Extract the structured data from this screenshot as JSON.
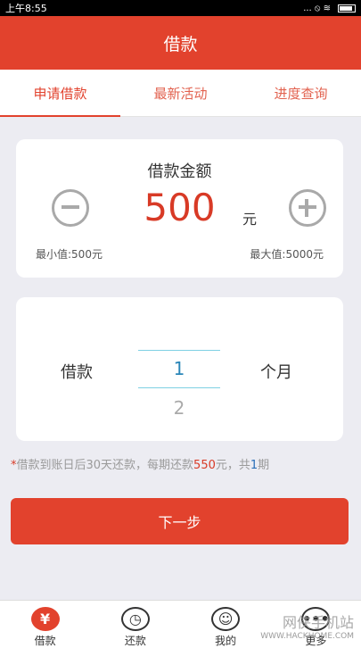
{
  "status_bar": {
    "time": "上午8:55",
    "icons": "... ⦸ ≋ "
  },
  "header": {
    "title": "借款"
  },
  "tabs": [
    {
      "label": "申请借款"
    },
    {
      "label": "最新活动"
    },
    {
      "label": "进度查询"
    }
  ],
  "amount": {
    "title": "借款金额",
    "value": "500",
    "unit": "元",
    "min_label": "最小值:500元",
    "max_label": "最大值:5000元"
  },
  "term": {
    "label": "借款",
    "selected": "1",
    "next": "2",
    "unit": "个月"
  },
  "notice": {
    "star": "*",
    "part1": "借款到账日后30天还款，每期还款",
    "amount": "550",
    "part2": "元，共",
    "count": "1",
    "part3": "期"
  },
  "next_button": {
    "label": "下一步"
  },
  "bottom_nav": [
    {
      "label": "借款",
      "icon": "¥",
      "icon_name": "yen-icon"
    },
    {
      "label": "还款",
      "icon": "◷",
      "icon_name": "clock-icon"
    },
    {
      "label": "我的",
      "icon": "☺",
      "icon_name": "user-icon"
    },
    {
      "label": "更多",
      "icon": "•••",
      "icon_name": "more-icon"
    }
  ],
  "watermark": {
    "cn": "网侠手机站",
    "url": "WWW.HACKHOME.COM"
  },
  "colors": {
    "brand": "#e2422d",
    "accent_blue": "#2a86b8"
  }
}
